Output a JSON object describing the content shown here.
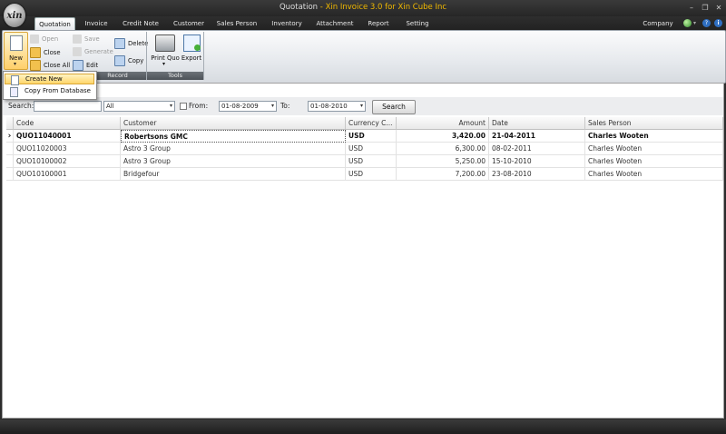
{
  "window": {
    "title_doc": "Quotation",
    "title_separator": " - ",
    "title_app": "Xin Invoice 3.0 for Xin Cube Inc",
    "logo_text": "xin",
    "controls": {
      "minimize": "–",
      "restore": "❐",
      "close": "✕"
    }
  },
  "tabs": [
    "Quotation",
    "Invoice",
    "Credit Note",
    "Customer",
    "Sales Person",
    "Inventory",
    "Attachment",
    "Report",
    "Setting"
  ],
  "company_tab": "Company",
  "ribbon": {
    "new_label": "New",
    "open_label": "Open",
    "close_label": "Close",
    "close_all_label": "Close All",
    "save_label": "Save",
    "generate_label": "Generate",
    "edit_label": "Edit",
    "delete_label": "Delete",
    "copy_label": "Copy",
    "print_label": "Print Quo",
    "export_label": "Export",
    "group_record": "Record",
    "group_tools": "Tools"
  },
  "new_menu": {
    "create_new": "Create New",
    "copy_from_database": "Copy From Database"
  },
  "filter": {
    "search_label": "Search:",
    "search_value": "",
    "scope_value": "All",
    "from_label": "From:",
    "from_checked": false,
    "from_value": "01-08-2009",
    "to_label": "To:",
    "to_value": "01-08-2010",
    "search_button": "Search"
  },
  "grid": {
    "columns": [
      "Code",
      "Customer",
      "Currency C...",
      "Amount",
      "Date",
      "Sales Person"
    ],
    "rows": [
      {
        "code": "QUO11040001",
        "customer": "Robertsons GMC",
        "currency": "USD",
        "amount": "3,420.00",
        "date": "21-04-2011",
        "sales": "Charles Wooten"
      },
      {
        "code": "QUO11020003",
        "customer": "Astro 3 Group",
        "currency": "USD",
        "amount": "6,300.00",
        "date": "08-02-2011",
        "sales": "Charles Wooten"
      },
      {
        "code": "QUO10100002",
        "customer": "Astro 3 Group",
        "currency": "USD",
        "amount": "5,250.00",
        "date": "15-10-2010",
        "sales": "Charles Wooten"
      },
      {
        "code": "QUO10100001",
        "customer": "Bridgefour",
        "currency": "USD",
        "amount": "7,200.00",
        "date": "23-08-2010",
        "sales": "Charles Wooten"
      }
    ],
    "selected_marker": "›"
  },
  "colors": {
    "accent": "#f0b800",
    "menu_highlight": "#ffd56a",
    "ribbon_group": "#555b61"
  }
}
